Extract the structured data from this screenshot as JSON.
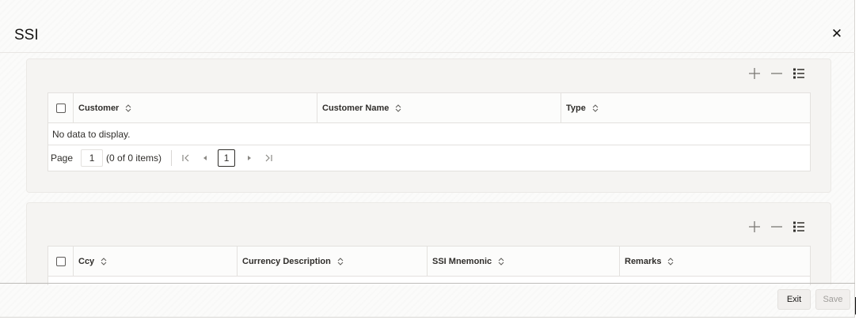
{
  "dialog": {
    "title": "SSI"
  },
  "panel1": {
    "columns": [
      "Customer",
      "Customer Name",
      "Type"
    ],
    "empty_text": "No data to display.",
    "pager": {
      "page_label": "Page",
      "page_value": "1",
      "count_text": "(0 of 0 items)",
      "current_page": "1"
    }
  },
  "panel2": {
    "columns": [
      "Ccy",
      "Currency Description",
      "SSI Mnemonic",
      "Remarks"
    ]
  },
  "footer": {
    "exit_label": "Exit",
    "save_label": "Save"
  },
  "icons": {
    "close": "close-icon",
    "add": "plus-icon",
    "remove": "minus-icon",
    "columns": "list-icon",
    "sort": "sort-icon",
    "first": "first-page-icon",
    "prev": "prev-page-icon",
    "next": "next-page-icon",
    "last": "last-page-icon"
  },
  "colors": {
    "text": "#161513",
    "panel": "#f5f4f2",
    "border": "#e3e1de"
  }
}
